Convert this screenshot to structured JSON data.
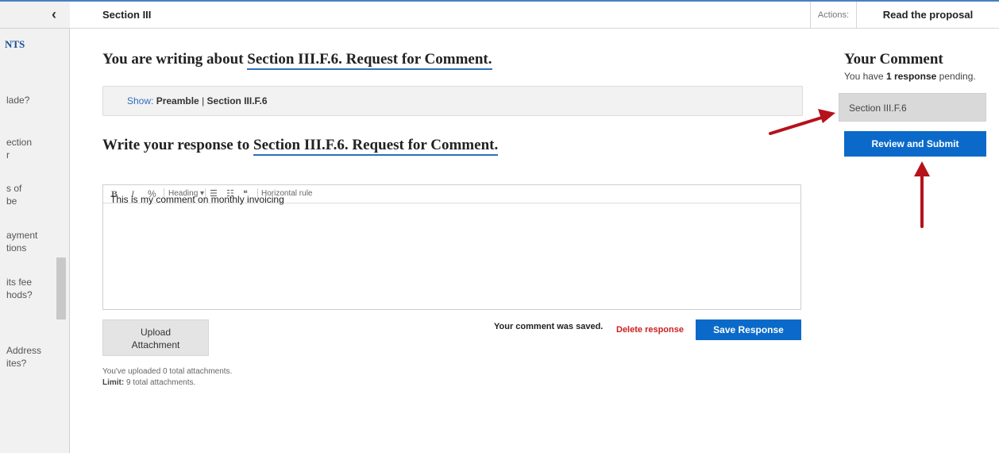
{
  "header": {
    "section_title": "Section III",
    "actions_label": "Actions:",
    "read_proposal_label": "Read the proposal"
  },
  "sidebar": {
    "heading": "NTS",
    "items": [
      {
        "lines": [
          "lade?"
        ]
      },
      {
        "lines": [
          "ection",
          "r"
        ]
      },
      {
        "lines": [
          "s of",
          "be"
        ]
      },
      {
        "lines": [
          "ayment",
          "tions"
        ]
      },
      {
        "lines": [
          "its fee",
          "hods?"
        ]
      },
      {
        "lines": [
          "Address",
          "ites?"
        ]
      }
    ]
  },
  "main": {
    "writing_prefix": "You are writing about",
    "writing_link": "Section III.F.6. Request for Comment.",
    "show_label": "Show:",
    "show_preamble": "Preamble",
    "show_separator": "|",
    "show_section": "Section III.F.6",
    "response_prefix": "Write your response to",
    "response_link": "Section III.F.6. Request for Comment.",
    "toolbar": {
      "bold": "B",
      "italic": "I",
      "link": "%",
      "heading": "Heading",
      "heading_caret": "▾",
      "ul": "☰",
      "ol": "☷",
      "quote": "❝",
      "hr": "Horizontal rule"
    },
    "editor_text": "This is my comment on monthly invoicing",
    "upload_line1": "Upload",
    "upload_line2": "Attachment",
    "saved_text": "Your comment was saved.",
    "delete_label": "Delete response",
    "save_label": "Save Response",
    "uploaded_note": "You've uploaded 0 total attachments.",
    "limit_label": "Limit:",
    "limit_text": "9 total attachments."
  },
  "right_panel": {
    "title": "Your Comment",
    "pending_prefix": "You have",
    "pending_count": "1 response",
    "pending_suffix": "pending.",
    "item_label": "Section III.F.6",
    "submit_label": "Review and Submit"
  },
  "colors": {
    "accent_blue": "#0b6ac9",
    "link_underline": "#2e6fbd",
    "delete_red": "#cc1f1f",
    "arrow_red": "#b5121b"
  }
}
